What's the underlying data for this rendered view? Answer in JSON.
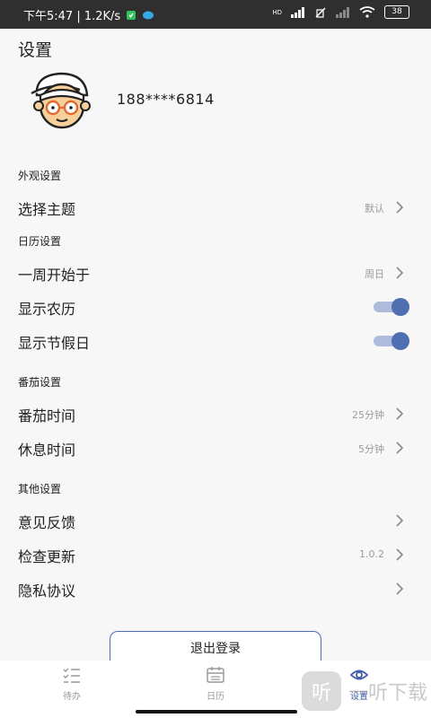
{
  "status_bar": {
    "time_speed": "下午5:47 | 1.2K/s",
    "network": "HD",
    "battery": "38"
  },
  "page": {
    "title": "设置"
  },
  "profile": {
    "phone": "188****6814"
  },
  "sections": {
    "appearance": {
      "title": "外观设置",
      "theme": {
        "label": "选择主题",
        "value": "默认"
      }
    },
    "calendar": {
      "title": "日历设置",
      "week_start": {
        "label": "一周开始于",
        "value": "周日"
      },
      "lunar": {
        "label": "显示农历",
        "on": true
      },
      "holiday": {
        "label": "显示节假日",
        "on": true
      }
    },
    "pomodoro": {
      "title": "番茄设置",
      "focus": {
        "label": "番茄时间",
        "value": "25分钟"
      },
      "rest": {
        "label": "休息时间",
        "value": "5分钟"
      }
    },
    "other": {
      "title": "其他设置",
      "feedback": {
        "label": "意见反馈"
      },
      "update": {
        "label": "检查更新",
        "value": "1.0.2"
      },
      "privacy": {
        "label": "隐私协议"
      }
    }
  },
  "logout_label": "退出登录",
  "tabbar": {
    "items": [
      {
        "label": "待办",
        "icon": "todo-list-icon",
        "active": false
      },
      {
        "label": "日历",
        "icon": "calendar-icon",
        "active": false
      },
      {
        "label": "设置",
        "icon": "eye-icon",
        "active": true
      }
    ]
  },
  "watermark": {
    "glyph": "听",
    "text": "一听下载"
  },
  "colors": {
    "accent": "#4f6fb1",
    "toggle_track": "#aebbdc",
    "status_bar": "#2f2f2f"
  }
}
